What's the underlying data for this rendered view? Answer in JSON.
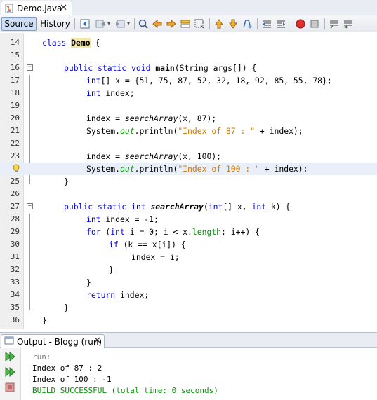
{
  "editor_tab": {
    "title": "Demo.java",
    "close": "✕"
  },
  "toolbar": {
    "source": "Source",
    "history": "History"
  },
  "code_lines": [
    {
      "num": "14"
    },
    {
      "num": "15"
    },
    {
      "num": "16"
    },
    {
      "num": "17"
    },
    {
      "num": "18"
    },
    {
      "num": "19"
    },
    {
      "num": "20"
    },
    {
      "num": "21"
    },
    {
      "num": "22"
    },
    {
      "num": "23"
    },
    {
      "num": "24"
    },
    {
      "num": "25"
    },
    {
      "num": "26"
    },
    {
      "num": "27"
    },
    {
      "num": "28"
    },
    {
      "num": "29"
    },
    {
      "num": "30"
    },
    {
      "num": "31"
    },
    {
      "num": "32"
    },
    {
      "num": "33"
    },
    {
      "num": "34"
    },
    {
      "num": "35"
    },
    {
      "num": "36"
    }
  ],
  "code": {
    "l14": {
      "kw": "class",
      "name": "Demo",
      "rest": " {"
    },
    "l16": {
      "kw": "public static void",
      "name": "main",
      "rest": "(String args[]) {"
    },
    "l17": {
      "kw": "int",
      "rest": "[] x = {51, 75, 87, 52, 32, 18, 92, 85, 55, 78};"
    },
    "l18": {
      "kw": "int",
      "rest": " index;"
    },
    "l20": {
      "pre": "index = ",
      "call": "searchArray",
      "rest": "(x, 87);"
    },
    "l21": {
      "pre": "System.",
      "fld": "out",
      "mid": ".println(",
      "str": "\"Index of 87 : \"",
      "rest": " + index);"
    },
    "l23": {
      "pre": "index = ",
      "call": "searchArray",
      "rest": "(x, 100);"
    },
    "l24": {
      "pre": "System.",
      "fld": "out",
      "mid": ".println(",
      "str": "\"Index of 100 : \"",
      "rest": " + index);"
    },
    "l25": {
      "rest": "}"
    },
    "l27": {
      "kw": "public static int",
      "name": "searchArray",
      "p1": "(",
      "kw2": "int",
      "p2": "[] x, ",
      "kw3": "int",
      "p3": " k) {"
    },
    "l28": {
      "kw": "int",
      "rest": " index = -1;"
    },
    "l29": {
      "kw": "for",
      "p1": " (",
      "kw2": "int",
      "p2": " i = 0; i < x.",
      "fld": "length",
      "p3": "; i++) {"
    },
    "l30": {
      "kw": "if",
      "rest": " (k == x[i]) {"
    },
    "l31": {
      "rest": "index = i;"
    },
    "l32": {
      "rest": "}"
    },
    "l33": {
      "rest": "}"
    },
    "l34": {
      "kw": "return",
      "rest": " index;"
    },
    "l35": {
      "rest": "}"
    },
    "l36": {
      "rest": "}"
    }
  },
  "output": {
    "tab_title": "Output - Blogg (run)",
    "close": "✕",
    "lines": [
      "run:",
      "Index of 87 : 2",
      "Index of 100 : -1",
      "BUILD SUCCESSFUL (total time: 0 seconds)"
    ]
  },
  "colors": {
    "keyword": "#0000e6",
    "string": "#ce7b00",
    "field": "#009900",
    "current_line": "#e9eff8",
    "highlight": "#f4e6a6"
  }
}
